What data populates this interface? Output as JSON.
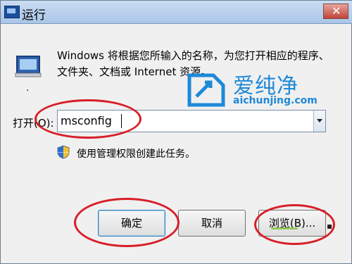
{
  "window": {
    "title": "运行",
    "close_glyph": "✕"
  },
  "description": "Windows 将根据您所输入的名称，为您打开相应的程序、文件夹、文档或 Internet 资源。",
  "watermark": {
    "name": "爱纯净",
    "url": "aichunjing.com"
  },
  "open_field": {
    "label": "打开(O):",
    "value": "msconfig"
  },
  "admin_note": "使用管理权限创建此任务。",
  "buttons": {
    "ok": "确定",
    "cancel": "取消",
    "browse": "浏览(B)..."
  },
  "colors": {
    "highlight_circle": "#d81e28",
    "watermark": "#1e89d8"
  },
  "icons": [
    "run-icon",
    "shield-icon",
    "close-icon",
    "dropdown-arrow-icon"
  ]
}
